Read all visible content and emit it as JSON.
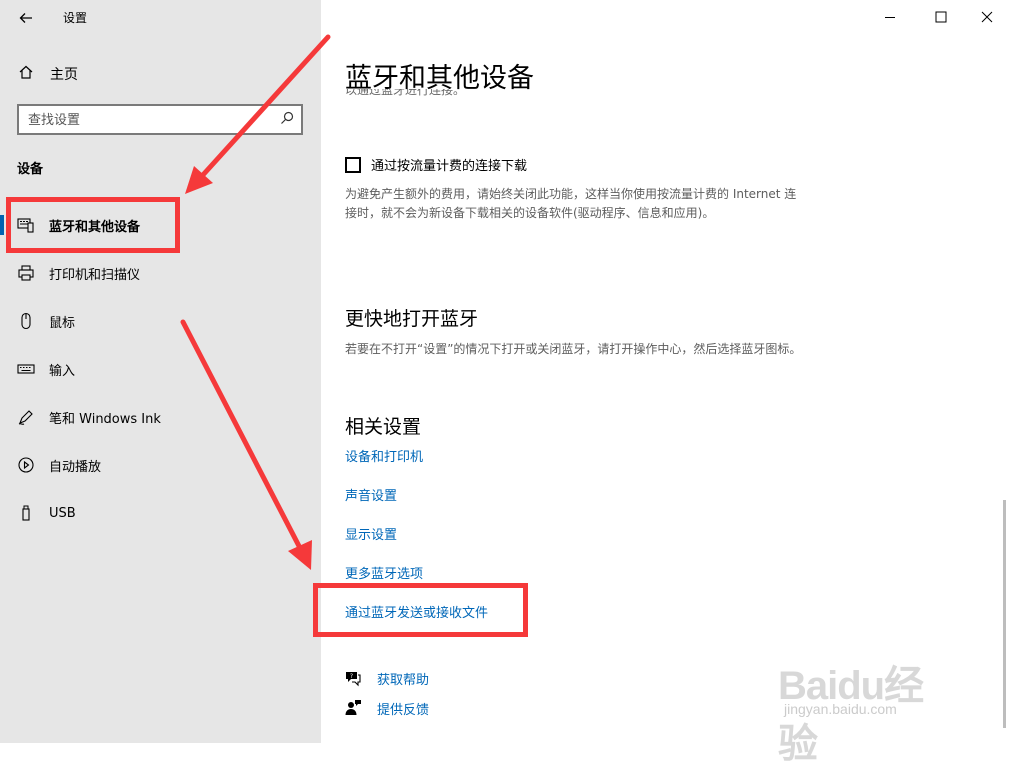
{
  "window": {
    "title": "设置",
    "back_icon": "arrow-left-icon",
    "controls": [
      "minimize-icon",
      "maximize-icon",
      "close-icon"
    ]
  },
  "sidebar": {
    "home_label": "主页",
    "search_placeholder": "查找设置",
    "section_label": "设备",
    "items": [
      {
        "label": "蓝牙和其他设备",
        "icon": "bluetooth-devices-icon",
        "active": true
      },
      {
        "label": "打印机和扫描仪",
        "icon": "printer-icon",
        "active": false
      },
      {
        "label": "鼠标",
        "icon": "mouse-icon",
        "active": false
      },
      {
        "label": "输入",
        "icon": "keyboard-icon",
        "active": false
      },
      {
        "label": "笔和 Windows Ink",
        "icon": "pen-icon",
        "active": false
      },
      {
        "label": "自动播放",
        "icon": "autoplay-icon",
        "active": false
      },
      {
        "label": "USB",
        "icon": "usb-icon",
        "active": false
      }
    ]
  },
  "main": {
    "page_title": "蓝牙和其他设备",
    "partial_text": "以通过蓝牙进行连接。",
    "metered": {
      "checkbox_label": "通过按流量计费的连接下载",
      "checked": false,
      "description": "为避免产生额外的费用，请始终关闭此功能，这样当你使用按流量计费的 Internet 连接时，就不会为新设备下载相关的设备软件(驱动程序、信息和应用)。"
    },
    "quick_bt": {
      "heading": "更快地打开蓝牙",
      "description": "若要在不打开“设置”的情况下打开或关闭蓝牙，请打开操作中心，然后选择蓝牙图标。"
    },
    "related": {
      "heading": "相关设置",
      "links": [
        "设备和打印机",
        "声音设置",
        "显示设置",
        "更多蓝牙选项",
        "通过蓝牙发送或接收文件"
      ]
    },
    "help": [
      {
        "label": "获取帮助",
        "icon": "help-chat-icon"
      },
      {
        "label": "提供反馈",
        "icon": "feedback-icon"
      }
    ]
  },
  "annotation_color": "#f5393a",
  "accent_color": "#0067b8",
  "watermark": {
    "logo_text": "Baidu经验",
    "url": "jingyan.baidu.com"
  }
}
